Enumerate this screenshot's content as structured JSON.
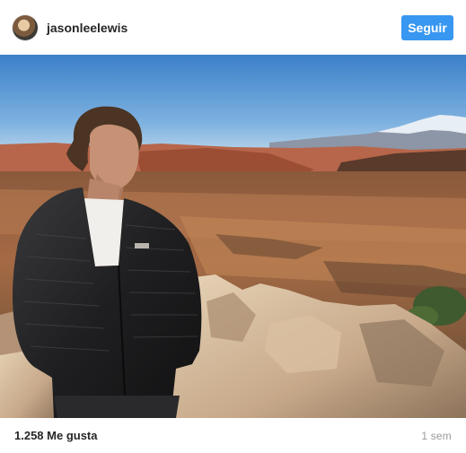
{
  "post": {
    "username": "jasonleelewis",
    "follow_label": "Seguir",
    "likes": "1.258 Me gusta",
    "time_ago": "1 sem"
  },
  "colors": {
    "follow_button": "#3897f0",
    "text": "#262626",
    "muted": "#999999"
  }
}
